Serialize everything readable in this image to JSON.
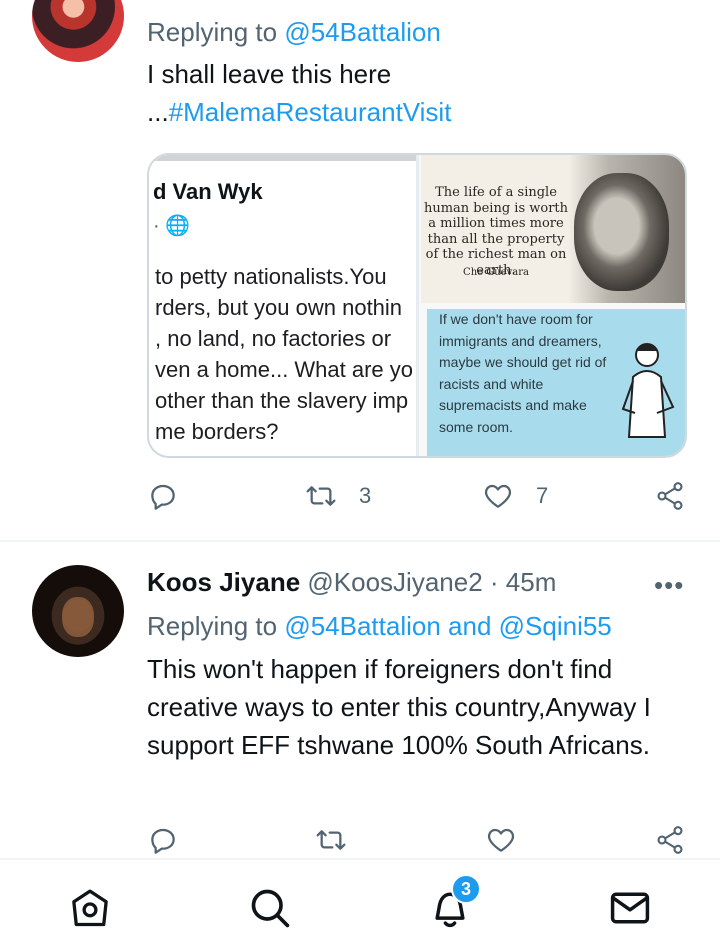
{
  "tweet1": {
    "replying_prefix": "Replying to ",
    "replying_handle": "@54Battalion",
    "text_line1": "I shall leave this here",
    "text_prefix": "...",
    "hashtag": "#MalemaRestaurantVisit",
    "media": {
      "left_name": "d Van Wyk",
      "left_meta": "· 🌐",
      "left_text": "to petty nationalists.You\nrders, but you own nothin\n, no land, no factories or\nven a home... What are yo\nother than the slavery imp\nme borders?",
      "quote_text": "The life of a single human being is worth a million times more than all the property of the richest man on earth.",
      "quote_author": "Che Guevara",
      "meme_text": "If we don't have room for immigrants and dreamers, maybe we should get rid of racists and white supremacists and make some room."
    },
    "retweets": "3",
    "likes": "7"
  },
  "tweet2": {
    "name": "Koos Jiyane",
    "handle": "@KoosJiyane2",
    "time": "· 45m",
    "more": "•••",
    "replying_prefix": "Replying to ",
    "replying_handles": "@54Battalion and @Sqini55",
    "text": "This won't happen if foreigners don't find creative ways to enter this country,Anyway I support EFF tshwane 100% South Africans."
  },
  "nav": {
    "notifications_badge": "3",
    "icons": [
      "home-icon",
      "search-icon",
      "bell-icon",
      "mail-icon"
    ]
  },
  "colors": {
    "accent": "#1d9bf0",
    "muted": "#536471",
    "text": "#0f1419"
  }
}
